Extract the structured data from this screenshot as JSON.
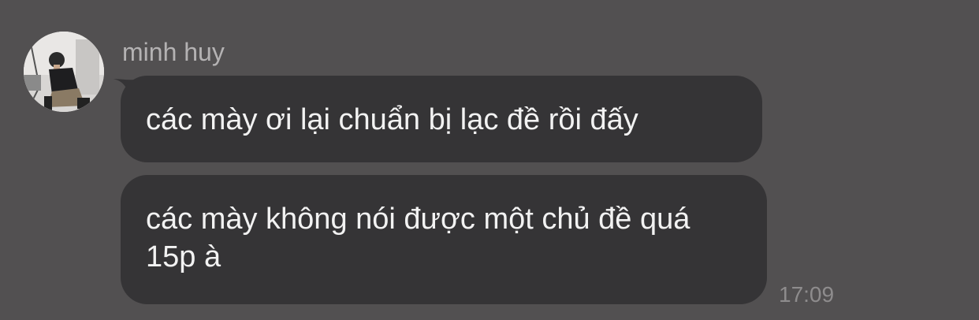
{
  "conversation": {
    "sender_name": "minh huy",
    "avatar_icon": "user-photo-avatar",
    "messages": [
      {
        "text": "các mày ơi lại chuẩn bị lạc đề rồi đấy"
      },
      {
        "text": "các mày không nói được một chủ đề quá 15p à"
      }
    ],
    "timestamp": "17:09"
  },
  "colors": {
    "background": "#525051",
    "bubble": "#353436",
    "bubble_text": "#f2f2f2",
    "sender_text": "#b4b2b3",
    "timestamp_text": "#8e8c8d"
  }
}
